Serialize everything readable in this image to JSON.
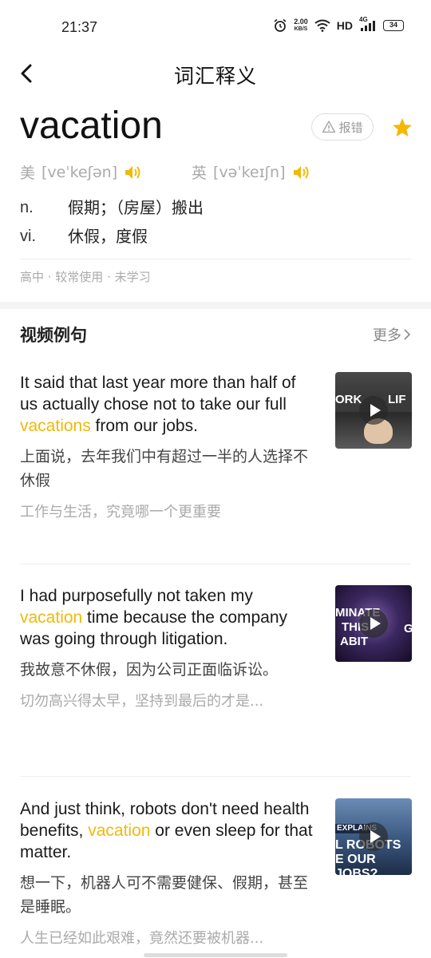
{
  "status_bar": {
    "time": "21:37",
    "net_speed_value": "2.00",
    "net_speed_unit": "KB/S",
    "network": "HD",
    "signal": "4G",
    "battery": "34",
    "icons": [
      "alarm-icon",
      "wifi-icon",
      "signal-icon",
      "battery-icon"
    ]
  },
  "nav": {
    "back_icon": "chevron-left-icon",
    "title": "词汇释义"
  },
  "word": {
    "headword": "vacation",
    "report_label": "报错",
    "report_icon": "warning-icon",
    "star_icon": "star-icon",
    "star_color": "#f5b800",
    "phonetics": {
      "us_label": "美",
      "us_ipa": "[veˈkeʃən]",
      "uk_label": "英",
      "uk_ipa": "[vəˈkeɪʃn]",
      "speaker_icon": "speaker-icon"
    },
    "definitions": [
      {
        "pos": "n.",
        "meaning": "假期；（房屋）搬出"
      },
      {
        "pos": "vi.",
        "meaning": "休假，度假"
      }
    ],
    "tags": "高中 · 较常使用 · 未学习"
  },
  "video_examples": {
    "section_title": "视频例句",
    "more_label": "更多",
    "items": [
      {
        "en_before": "It said that last year more than half of us actually chose not to take our full ",
        "en_highlight": "vacations",
        "en_after": " from our jobs.",
        "cn": "上面说，去年我们中有超过一半的人选择不休假",
        "source": "工作与生活，究竟哪一个更重要",
        "thumb_caption_left": "ORK",
        "thumb_caption_right": "LIF"
      },
      {
        "en_before": "I had purposefully not taken my ",
        "en_highlight": "vacation",
        "en_after": " time because the company was going through litigation.",
        "cn": "我故意不休假，因为公司正面临诉讼。",
        "source": "切勿高兴得太早，坚持到最后的才是...",
        "thumb_caption_lines": [
          "MINATE",
          "THIS",
          "ABIT"
        ],
        "thumb_caption_right": "G"
      },
      {
        "en_before": "And just think, robots don't need health benefits, ",
        "en_highlight": "vacation",
        "en_after": " or even sleep for that matter.",
        "cn": "想一下，机器人可不需要健保、假期，甚至是睡眠。",
        "source": "人生已经如此艰难，竟然还要被机器...",
        "thumb_caption_top": "EXPLAINS",
        "thumb_caption_lines": [
          "L ROBOTS",
          "E OUR JOBS?"
        ]
      }
    ]
  },
  "colors": {
    "accent": "#f0b90b",
    "text": "#222222",
    "muted": "#aaaaaa"
  }
}
